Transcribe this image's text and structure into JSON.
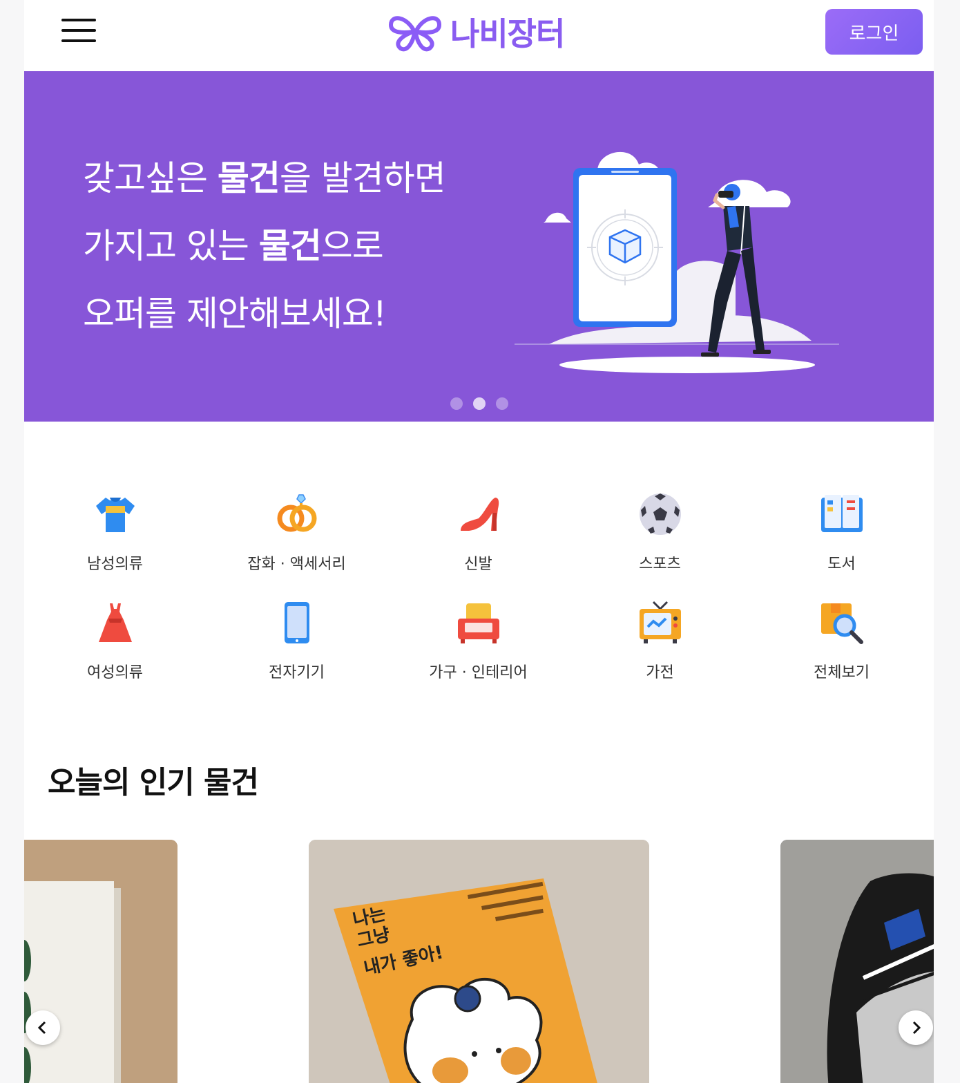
{
  "header": {
    "logo_text": "나비장터",
    "login_label": "로그인"
  },
  "banner": {
    "line1_a": "갖고싶은 ",
    "line1_b": "물건",
    "line1_c": "을 발견하면",
    "line2_a": "가지고 있는 ",
    "line2_b": "물건",
    "line2_c": "으로",
    "line3": "오퍼를 제안해보세요!",
    "slide_count": 3,
    "active_slide": 2
  },
  "categories": [
    {
      "label": "남성의류",
      "icon": "shirt-icon"
    },
    {
      "label": "잡화 · 액세서리",
      "icon": "rings-icon"
    },
    {
      "label": "신발",
      "icon": "high-heel-icon"
    },
    {
      "label": "스포츠",
      "icon": "soccer-ball-icon"
    },
    {
      "label": "도서",
      "icon": "book-icon"
    },
    {
      "label": "여성의류",
      "icon": "dress-icon"
    },
    {
      "label": "전자기기",
      "icon": "smartphone-icon"
    },
    {
      "label": "가구 · 인테리어",
      "icon": "armchair-icon"
    },
    {
      "label": "가전",
      "icon": "tv-icon"
    },
    {
      "label": "전체보기",
      "icon": "search-box-icon"
    }
  ],
  "popular": {
    "title": "오늘의 인기 물건",
    "book_title_1": "나는",
    "book_title_2": "그냥",
    "book_title_3": "내가 좋아!"
  },
  "colors": {
    "brand": "#8756d8",
    "accent": "#8b5cf6"
  }
}
